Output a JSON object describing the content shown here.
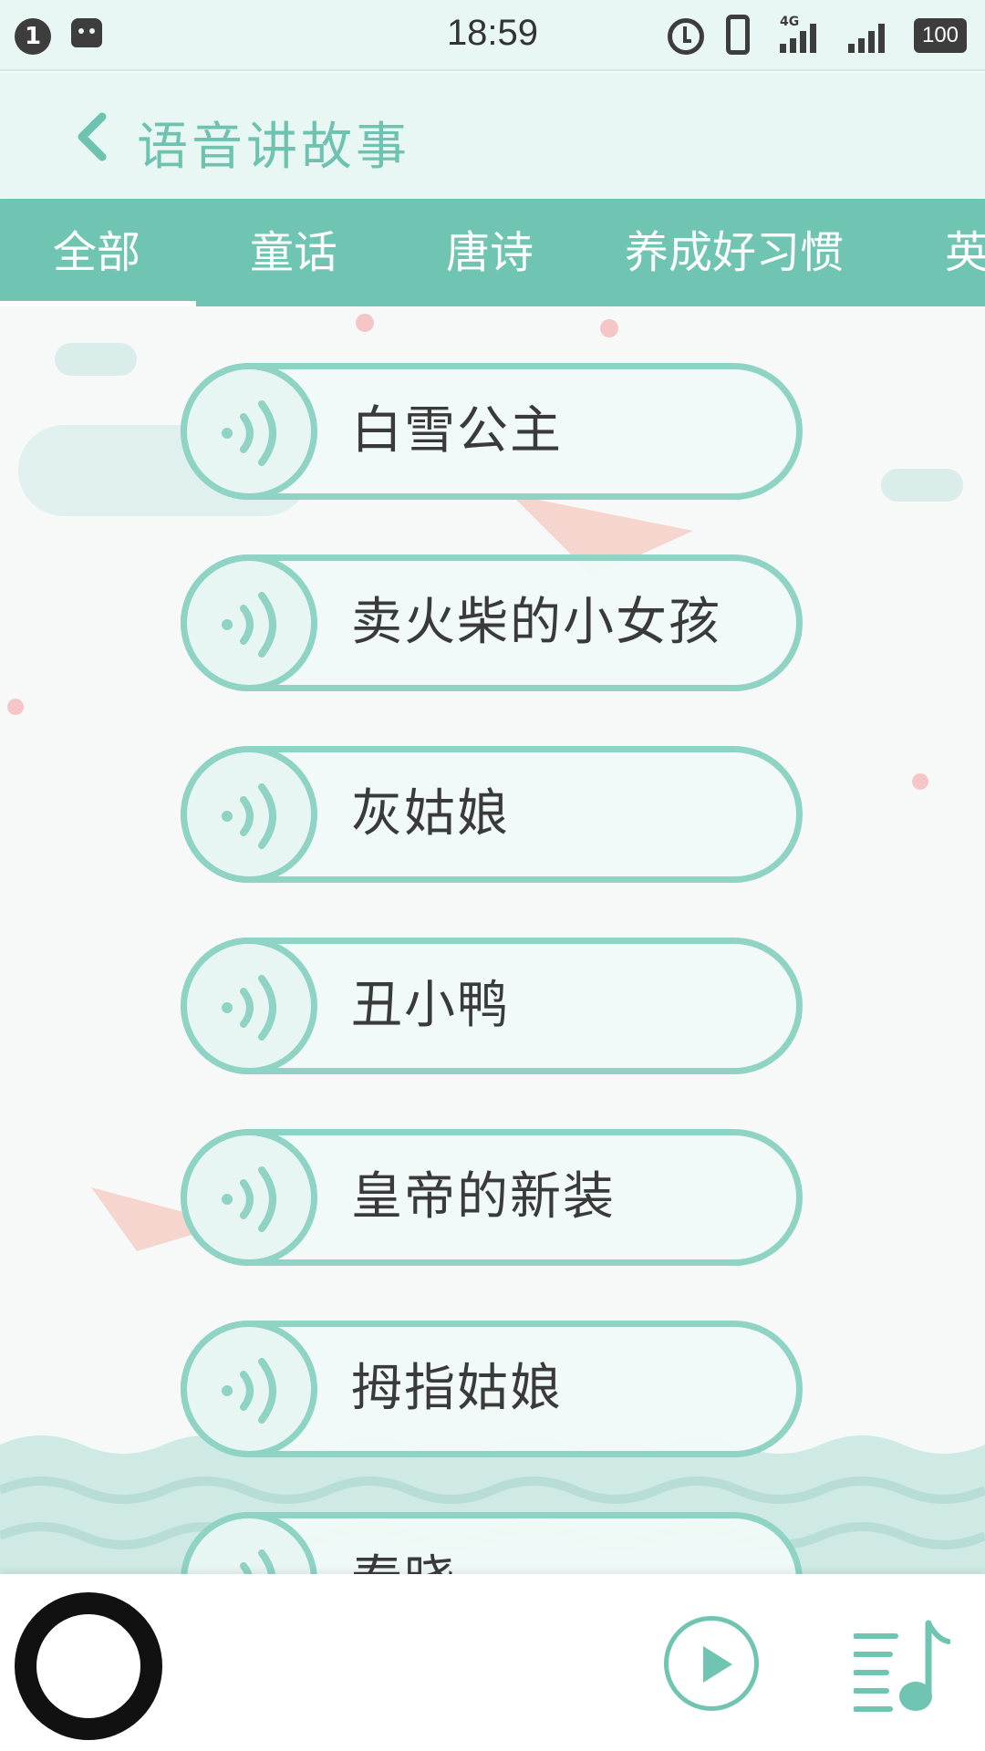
{
  "status_bar": {
    "notification_count": "1",
    "time": "18:59",
    "network": "4G",
    "battery": "100"
  },
  "header": {
    "title": "语音讲故事",
    "back_icon": "back-chevron-icon"
  },
  "tabs": [
    {
      "label": "全部",
      "selected": true
    },
    {
      "label": "童话",
      "selected": false
    },
    {
      "label": "唐诗",
      "selected": false
    },
    {
      "label": "养成好习惯",
      "selected": false
    },
    {
      "label": "英",
      "selected": false
    }
  ],
  "stories": [
    {
      "title": "白雪公主"
    },
    {
      "title": "卖火柴的小女孩"
    },
    {
      "title": "灰姑娘"
    },
    {
      "title": "丑小鸭"
    },
    {
      "title": "皇帝的新装"
    },
    {
      "title": "拇指姑娘"
    },
    {
      "title": "春晓"
    }
  ],
  "player": {
    "play_icon": "play-icon",
    "playlist_icon": "playlist-icon"
  },
  "colors": {
    "accent": "#6fc4b2",
    "header_bg": "#e8f6f4",
    "item_border": "#8fd3c4",
    "text": "#3a3a3a"
  }
}
